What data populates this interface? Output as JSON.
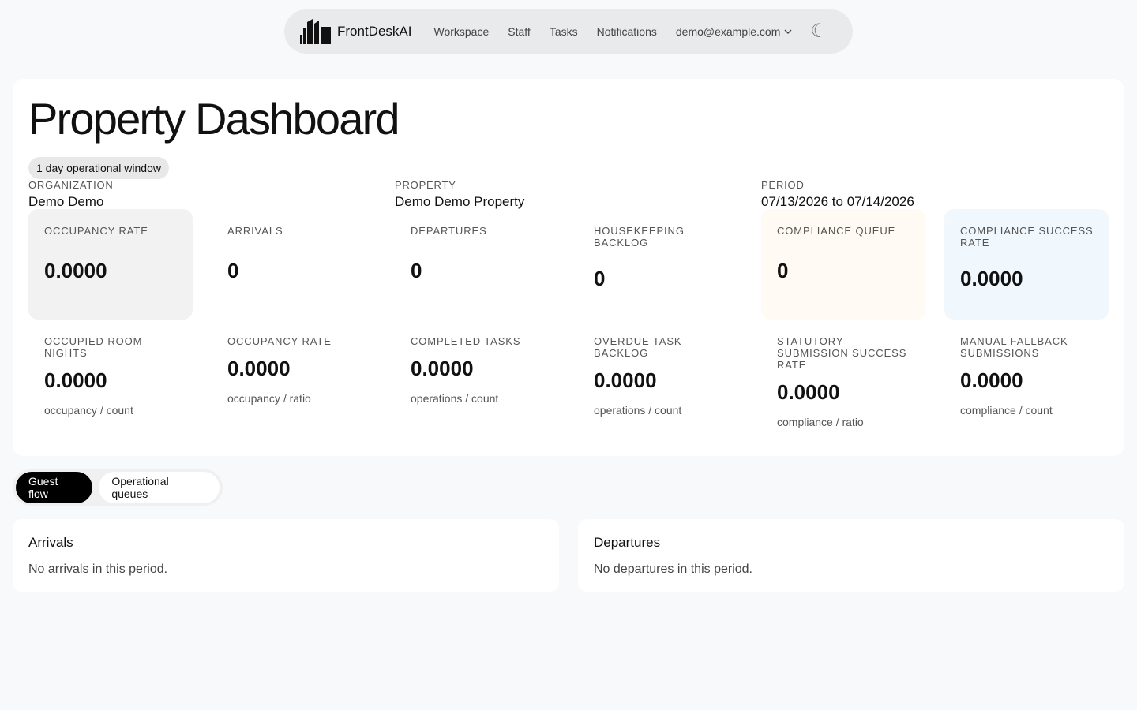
{
  "nav": {
    "brand": "FrontDeskAI",
    "links": [
      "Workspace",
      "Staff",
      "Tasks",
      "Notifications"
    ],
    "user_email": "demo@example.com"
  },
  "header": {
    "title": "Property Dashboard",
    "window_badge": "1 day operational window",
    "organization_label": "ORGANIZATION",
    "organization_value": "Demo Demo",
    "property_label": "PROPERTY",
    "property_value": "Demo Demo Property",
    "period_label": "PERIOD",
    "period_value": "07/13/2026 to 07/14/2026"
  },
  "kpis": [
    {
      "label": "OCCUPANCY RATE",
      "value": "0.0000"
    },
    {
      "label": "ARRIVALS",
      "value": "0"
    },
    {
      "label": "DEPARTURES",
      "value": "0"
    },
    {
      "label": "HOUSEKEEPING BACKLOG",
      "value": "0"
    },
    {
      "label": "COMPLIANCE QUEUE",
      "value": "0"
    },
    {
      "label": "COMPLIANCE SUCCESS RATE",
      "value": "0.0000"
    }
  ],
  "metrics": [
    {
      "label": "OCCUPIED ROOM NIGHTS",
      "value": "0.0000",
      "sub": "occupancy / count"
    },
    {
      "label": "OCCUPANCY RATE",
      "value": "0.0000",
      "sub": "occupancy / ratio"
    },
    {
      "label": "COMPLETED TASKS",
      "value": "0.0000",
      "sub": "operations / count"
    },
    {
      "label": "OVERDUE TASK BACKLOG",
      "value": "0.0000",
      "sub": "operations / count"
    },
    {
      "label": "STATUTORY SUBMISSION SUCCESS RATE",
      "value": "0.0000",
      "sub": "compliance / ratio"
    },
    {
      "label": "MANUAL FALLBACK SUBMISSIONS",
      "value": "0.0000",
      "sub": "compliance / count"
    }
  ],
  "tabs": [
    {
      "label": "Guest flow",
      "active": true
    },
    {
      "label": "Operational queues",
      "active": false
    }
  ],
  "panels": {
    "arrivals_title": "Arrivals",
    "arrivals_empty": "No arrivals in this period.",
    "departures_title": "Departures",
    "departures_empty": "No departures in this period."
  },
  "icons": {
    "logo": "buildings-logo-icon",
    "user_menu": "chevron-down-icon",
    "theme": "moon-icon"
  }
}
